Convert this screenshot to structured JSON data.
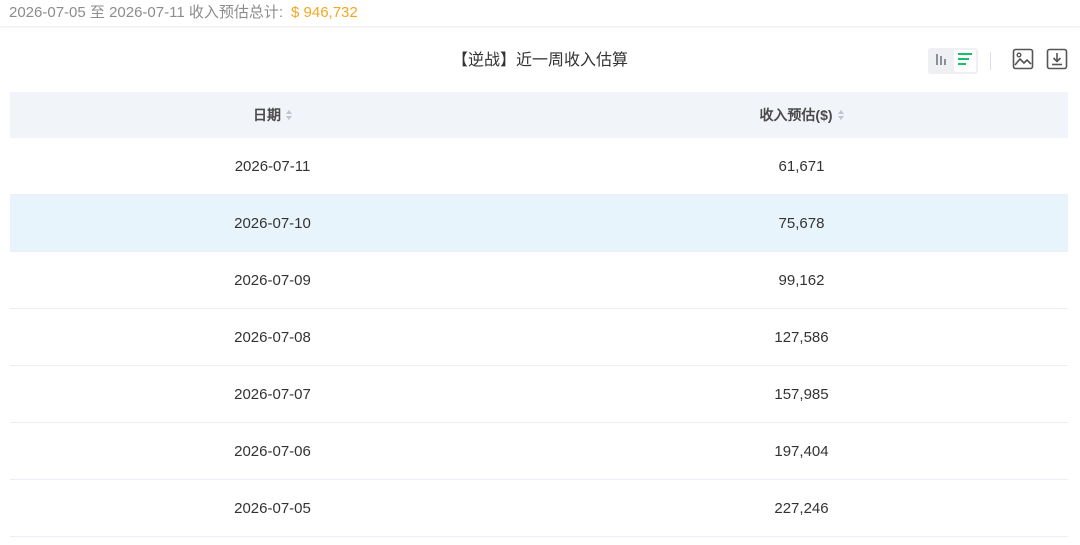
{
  "summary": {
    "text": "2026-07-05 至 2026-07-11 收入预估总计:",
    "amount": "$ 946,732"
  },
  "title": "【逆战】近一周收入估算",
  "toolbar": {
    "view_toggle": {
      "bar_icon": "bar-chart-icon",
      "table_icon": "table-list-icon",
      "active": "table"
    },
    "image_icon": "image-icon",
    "download_icon": "download-icon"
  },
  "table": {
    "headers": {
      "date": "日期",
      "revenue": "收入预估($)"
    },
    "rows": [
      {
        "date": "2026-07-11",
        "revenue": "61,671"
      },
      {
        "date": "2026-07-10",
        "revenue": "75,678"
      },
      {
        "date": "2026-07-09",
        "revenue": "99,162"
      },
      {
        "date": "2026-07-08",
        "revenue": "127,586"
      },
      {
        "date": "2026-07-07",
        "revenue": "157,985"
      },
      {
        "date": "2026-07-06",
        "revenue": "197,404"
      },
      {
        "date": "2026-07-05",
        "revenue": "227,246"
      }
    ]
  },
  "colors": {
    "accent": "#f5a623",
    "active_icon": "#19be6b",
    "header_bg": "#f1f4f8",
    "highlight_row": "#e8f4fc"
  }
}
